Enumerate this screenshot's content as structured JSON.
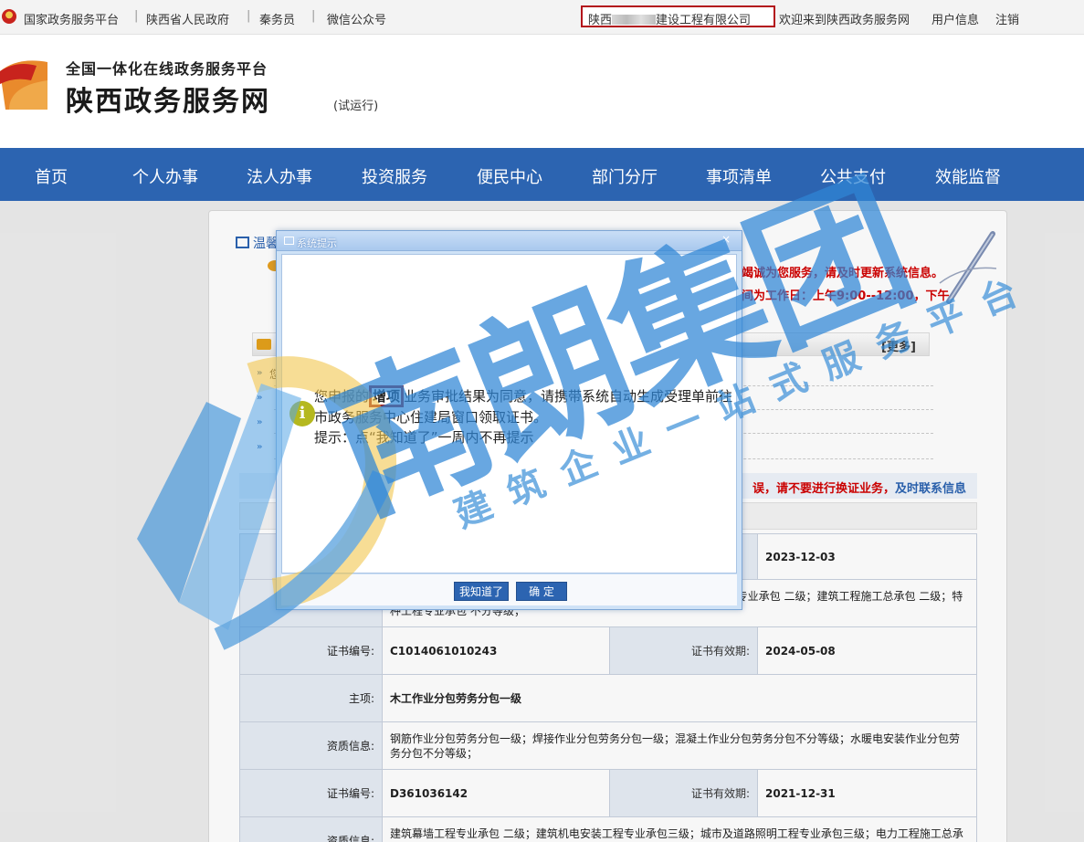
{
  "topbar": {
    "links": [
      "国家政务服务平台",
      "陕西省人民政府",
      "秦务员",
      "微信公众号"
    ],
    "company_prefix": "陕西",
    "company_suffix": "建设工程有限公司",
    "welcome": "欢迎来到陕西政务服务网",
    "user_info": "用户信息",
    "logout": "注销"
  },
  "header": {
    "subtitle": "全国一体化在线政务服务平台",
    "title": "陕西政务服务网",
    "trial": "(试运行)"
  },
  "nav": [
    "首页",
    "个人办事",
    "法人办事",
    "投资服务",
    "便民中心",
    "部门分厅",
    "事项清单",
    "公共支付",
    "效能监督"
  ],
  "panel": {
    "title": "温馨",
    "notice1": "竭诚为您服务，请及时更新系统信息。",
    "notice2": "间为工作日：上午9:00--12:00，下午",
    "more": "[更多]",
    "news_prefix": "您",
    "notice3_red": "误，请不要进行换证业务，",
    "notice3_blue": "及时联系信息"
  },
  "table": {
    "rows": [
      {
        "type": "pair",
        "val1": "",
        "label2": "",
        "val2": "2023-12-03"
      },
      {
        "type": "wide",
        "label": "",
        "value": "防设施工程专业承包 一级；市政公用工程施工总承包 二级；钢结构工程专业承包 二级；建筑工程施工总承包 二级；特种工程专业承包 不分等级；"
      },
      {
        "type": "pair",
        "label1": "证书编号:",
        "val1": "C1014061010243",
        "label2": "证书有效期:",
        "val2": "2024-05-08"
      },
      {
        "type": "wide",
        "label": "主项:",
        "value": "木工作业分包劳务分包一级"
      },
      {
        "type": "wide",
        "label": "资质信息:",
        "value": "钢筋作业分包劳务分包一级；焊接作业分包劳务分包一级；混凝土作业分包劳务分包不分等级；水暖电安装作业分包劳务分包不分等级；"
      },
      {
        "type": "pair",
        "label1": "证书编号:",
        "val1": "D361036142",
        "label2": "证书有效期:",
        "val2": "2021-12-31"
      },
      {
        "type": "wide",
        "label": "资质信息:",
        "value": "建筑幕墙工程专业承包 二级；建筑机电安装工程专业承包三级；城市及道路照明工程专业承包三级；电力工程施工总承包三级；机电工程施工总承包三级；石油化工工程施工总承包三级；模板脚手架专业承包不分等级"
      }
    ]
  },
  "dialog": {
    "title": "系统提示",
    "close": "×",
    "msg_before": "您申报的",
    "msg_highlight": "增项",
    "msg_after": "业务审批结果为同意，请携带系统自动生成受理单前往市政务服务中心住建局窗口领取证书。",
    "hint": "提示：点“我知道了”一周内不再提示",
    "btn_know": "我知道了",
    "btn_ok": "确  定"
  },
  "watermark": {
    "main": "南朗集团",
    "slogan": "建筑企业一站式服务平台"
  },
  "colors": {
    "nav_blue": "#2c64b1",
    "highlight_border": "#b3121b",
    "watermark_blue": "#3a8fd8"
  }
}
